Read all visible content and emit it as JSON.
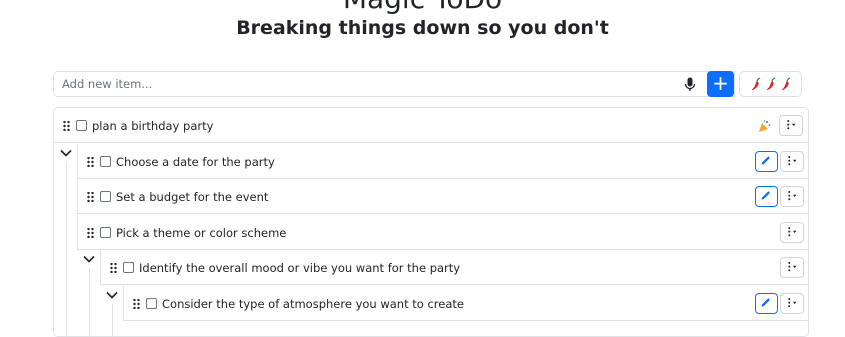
{
  "header": {
    "title": "Magic ToDo",
    "subtitle": "Breaking things down so you don't"
  },
  "new_item": {
    "placeholder": "Add new item...",
    "add_label": "+",
    "spiciness_level": 3
  },
  "tasks": [
    {
      "label": "plan a birthday party",
      "depth": 0,
      "edit": false,
      "party_icon": true
    },
    {
      "label": "Choose a date for the party",
      "depth": 1,
      "edit": true
    },
    {
      "label": "Set a budget for the event",
      "depth": 1,
      "edit": true
    },
    {
      "label": "Pick a theme or color scheme",
      "depth": 1,
      "edit": false
    },
    {
      "label": "Identify the overall mood or vibe you want for the party",
      "depth": 2,
      "edit": false
    },
    {
      "label": "Consider the type of atmosphere you want to create",
      "depth": 3,
      "edit": true
    }
  ],
  "colors": {
    "primary": "#0d6efd",
    "border": "#dee2e6",
    "text": "#212529"
  }
}
